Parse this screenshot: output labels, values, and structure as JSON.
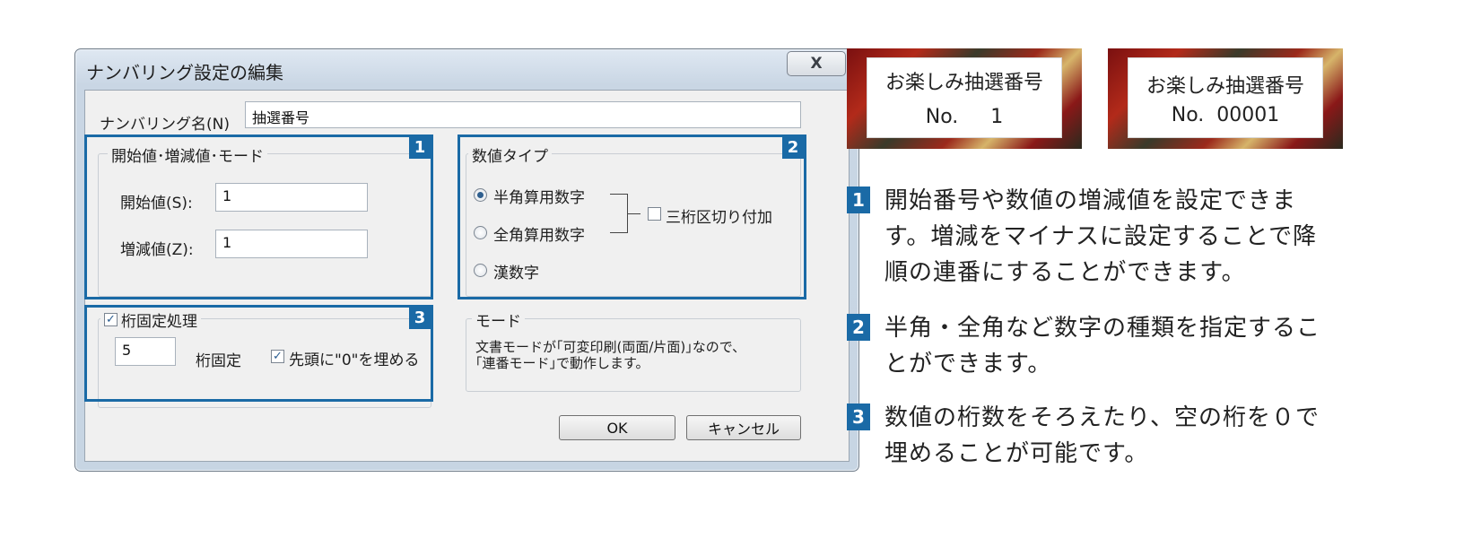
{
  "dialog": {
    "title": "ナンバリング設定の編集",
    "close_glyph": "X",
    "name_label": "ナンバリング名(N)",
    "name_value": "抽選番号",
    "group1": {
      "title": "開始値･増減値･モード",
      "start_label": "開始値(S):",
      "start_value": "1",
      "step_label": "増減値(Z):",
      "step_value": "1"
    },
    "group2": {
      "title": "数値タイプ",
      "options": [
        "半角算用数字",
        "全角算用数字",
        "漢数字"
      ],
      "selected": "半角算用数字",
      "comma_label": "三桁区切り付加",
      "comma_checked": false
    },
    "group3": {
      "title": "桁固定処理",
      "checked": true,
      "digits_value": "5",
      "digits_label": "桁固定",
      "zero_fill_label": "先頭に\"0\"を埋める",
      "zero_fill_checked": true
    },
    "mode": {
      "title": "モード",
      "text_line1": "文書モードが｢可変印刷(両面/片面)｣なので、",
      "text_line2": "｢連番モード｣で動作します。"
    },
    "ok_label": "OK",
    "cancel_label": "キャンセル"
  },
  "badges": [
    "1",
    "2",
    "3"
  ],
  "tickets": [
    {
      "title": "お楽しみ抽選番号",
      "number": "No.　  1"
    },
    {
      "title": "お楽しみ抽選番号",
      "number": "No.  00001"
    }
  ],
  "notes": [
    {
      "num": "1",
      "lines": [
        "開始番号や数値の増減値を設定できま",
        "す。増減をマイナスに設定することで降",
        "順の連番にすることができます。"
      ]
    },
    {
      "num": "2",
      "lines": [
        "半角・全角など数字の種類を指定するこ",
        "とができます。"
      ]
    },
    {
      "num": "3",
      "lines": [
        "数値の桁数をそろえたり、空の桁を０で",
        "埋めることが可能です。"
      ]
    }
  ],
  "colors": {
    "accent": "#1a6aa6"
  }
}
